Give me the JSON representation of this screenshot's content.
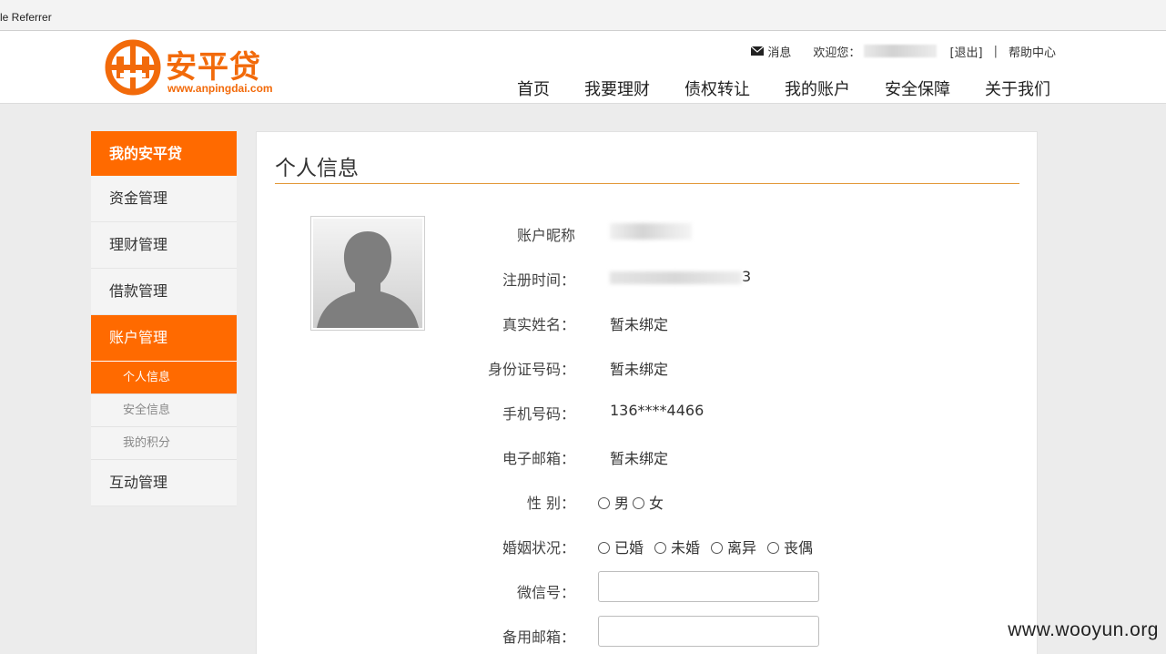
{
  "browser": {
    "tab_title": "le Referrer"
  },
  "brand": {
    "name": "安平贷",
    "url": "www.anpingdai.com",
    "color": "#f26a0a"
  },
  "topbar": {
    "message_label": "消息",
    "welcome_label": "欢迎您：",
    "logout_label": "[退出]",
    "separator": "|",
    "help_label": "帮助中心"
  },
  "nav": [
    "首页",
    "我要理财",
    "债权转让",
    "我的账户",
    "安全保障",
    "关于我们"
  ],
  "sidebar": {
    "header": "我的安平贷",
    "items": [
      {
        "label": "资金管理"
      },
      {
        "label": "理财管理"
      },
      {
        "label": "借款管理"
      },
      {
        "label": "账户管理",
        "active": true
      }
    ],
    "subitems": [
      {
        "label": "个人信息",
        "active": true
      },
      {
        "label": "安全信息"
      },
      {
        "label": "我的积分"
      }
    ],
    "last_item": "互动管理",
    "accent": "#ff6a00"
  },
  "profile": {
    "title": "个人信息",
    "fields": {
      "nickname_label": "账户昵称",
      "regtime_label": "注册时间：",
      "regtime_tail": "3",
      "realname_label": "真实姓名：",
      "realname_value": "暂未绑定",
      "idcard_label": "身份证号码：",
      "idcard_value": "暂未绑定",
      "phone_label": "手机号码：",
      "phone_value": "136****4466",
      "email_label": "电子邮箱：",
      "email_value": "暂未绑定",
      "gender_label": "性 别：",
      "gender_options": [
        "男",
        "女"
      ],
      "marital_label": "婚姻状况：",
      "marital_options": [
        "已婚",
        "未婚",
        "离异",
        "丧偶"
      ],
      "wechat_label": "微信号：",
      "backup_email_label": "备用邮箱："
    }
  },
  "watermark": "www.wooyun.org"
}
